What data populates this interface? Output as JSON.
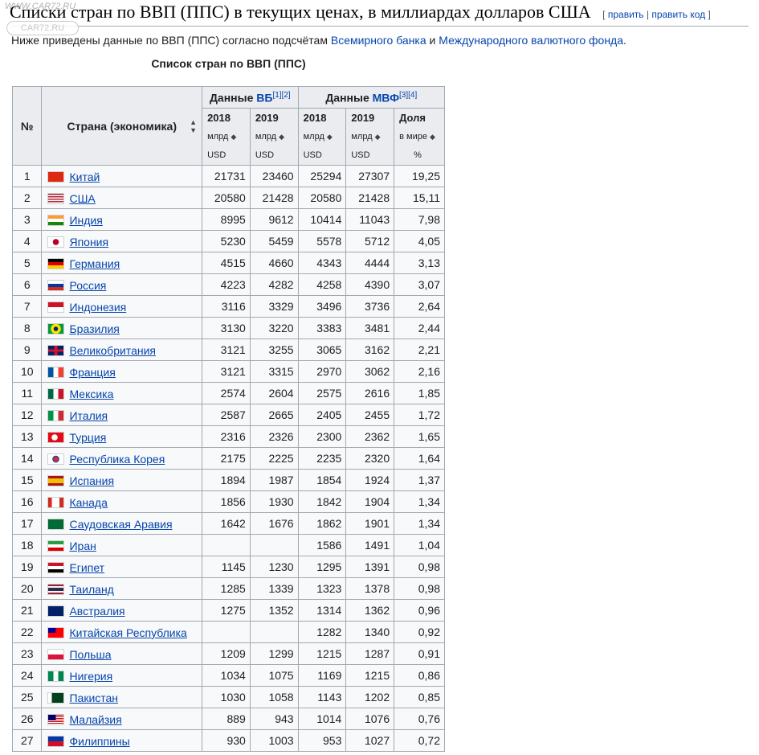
{
  "heading": {
    "title": "Списки стран по ВВП (ППС) в текущих ценах, в миллиардах долларов США",
    "edit_open": "[",
    "edit_label": "править",
    "edit_sep": "|",
    "edit_code_label": "править код",
    "edit_close": "]"
  },
  "watermark": {
    "url": "WWW.CAR72.RU",
    "logo": "CAR72.RU"
  },
  "intro": {
    "prefix": "Ниже приведены данные по ВВП (ППС) согласно подсчётам",
    "link1": "Всемирного банка",
    "and": "и",
    "link2": "Международного валютного фонда",
    "suffix": "."
  },
  "table": {
    "caption": "Список стран по ВВП (ППС)",
    "headers": {
      "num": "№",
      "country": "Страна (экономика)",
      "wb_prefix": "Данные",
      "wb_link": "ВБ",
      "wb_refs": "[1][2]",
      "imf_prefix": "Данные",
      "imf_link": "МВФ",
      "imf_refs": "[3][4]",
      "y2018": "2018",
      "y2019": "2019",
      "unit_line1": "млрд",
      "unit_line2": "USD",
      "share_line1": "Доля",
      "share_line2": "в мире",
      "share_line3": "%"
    },
    "rows": [
      {
        "n": "1",
        "flag": "cn",
        "country": "Китай",
        "wb2018": "21731",
        "wb2019": "23460",
        "imf2018": "25294",
        "imf2019": "27307",
        "share": "19,25"
      },
      {
        "n": "2",
        "flag": "us",
        "country": "США",
        "wb2018": "20580",
        "wb2019": "21428",
        "imf2018": "20580",
        "imf2019": "21428",
        "share": "15,11"
      },
      {
        "n": "3",
        "flag": "in",
        "country": "Индия",
        "wb2018": "8995",
        "wb2019": "9612",
        "imf2018": "10414",
        "imf2019": "11043",
        "share": "7,98"
      },
      {
        "n": "4",
        "flag": "jp",
        "country": "Япония",
        "wb2018": "5230",
        "wb2019": "5459",
        "imf2018": "5578",
        "imf2019": "5712",
        "share": "4,05"
      },
      {
        "n": "5",
        "flag": "de",
        "country": "Германия",
        "wb2018": "4515",
        "wb2019": "4660",
        "imf2018": "4343",
        "imf2019": "4444",
        "share": "3,13"
      },
      {
        "n": "6",
        "flag": "ru",
        "country": "Россия",
        "wb2018": "4223",
        "wb2019": "4282",
        "imf2018": "4258",
        "imf2019": "4390",
        "share": "3,07"
      },
      {
        "n": "7",
        "flag": "id",
        "country": "Индонезия",
        "wb2018": "3116",
        "wb2019": "3329",
        "imf2018": "3496",
        "imf2019": "3736",
        "share": "2,64"
      },
      {
        "n": "8",
        "flag": "br",
        "country": "Бразилия",
        "wb2018": "3130",
        "wb2019": "3220",
        "imf2018": "3383",
        "imf2019": "3481",
        "share": "2,44"
      },
      {
        "n": "9",
        "flag": "gb",
        "country": "Великобритания",
        "wb2018": "3121",
        "wb2019": "3255",
        "imf2018": "3065",
        "imf2019": "3162",
        "share": "2,21"
      },
      {
        "n": "10",
        "flag": "fr",
        "country": "Франция",
        "wb2018": "3121",
        "wb2019": "3315",
        "imf2018": "2970",
        "imf2019": "3062",
        "share": "2,16"
      },
      {
        "n": "11",
        "flag": "mx",
        "country": "Мексика",
        "wb2018": "2574",
        "wb2019": "2604",
        "imf2018": "2575",
        "imf2019": "2616",
        "share": "1,85"
      },
      {
        "n": "12",
        "flag": "it",
        "country": "Италия",
        "wb2018": "2587",
        "wb2019": "2665",
        "imf2018": "2405",
        "imf2019": "2455",
        "share": "1,72"
      },
      {
        "n": "13",
        "flag": "tr",
        "country": "Турция",
        "wb2018": "2316",
        "wb2019": "2326",
        "imf2018": "2300",
        "imf2019": "2362",
        "share": "1,65"
      },
      {
        "n": "14",
        "flag": "kr",
        "country": "Республика Корея",
        "wb2018": "2175",
        "wb2019": "2225",
        "imf2018": "2235",
        "imf2019": "2320",
        "share": "1,64"
      },
      {
        "n": "15",
        "flag": "es",
        "country": "Испания",
        "wb2018": "1894",
        "wb2019": "1987",
        "imf2018": "1854",
        "imf2019": "1924",
        "share": "1,37"
      },
      {
        "n": "16",
        "flag": "ca",
        "country": "Канада",
        "wb2018": "1856",
        "wb2019": "1930",
        "imf2018": "1842",
        "imf2019": "1904",
        "share": "1,34"
      },
      {
        "n": "17",
        "flag": "sa",
        "country": "Саудовская Аравия",
        "wb2018": "1642",
        "wb2019": "1676",
        "imf2018": "1862",
        "imf2019": "1901",
        "share": "1,34"
      },
      {
        "n": "18",
        "flag": "ir",
        "country": "Иран",
        "wb2018": "",
        "wb2019": "",
        "imf2018": "1586",
        "imf2019": "1491",
        "share": "1,04"
      },
      {
        "n": "19",
        "flag": "eg",
        "country": "Египет",
        "wb2018": "1145",
        "wb2019": "1230",
        "imf2018": "1295",
        "imf2019": "1391",
        "share": "0,98"
      },
      {
        "n": "20",
        "flag": "th",
        "country": "Таиланд",
        "wb2018": "1285",
        "wb2019": "1339",
        "imf2018": "1323",
        "imf2019": "1378",
        "share": "0,98"
      },
      {
        "n": "21",
        "flag": "au",
        "country": "Австралия",
        "wb2018": "1275",
        "wb2019": "1352",
        "imf2018": "1314",
        "imf2019": "1362",
        "share": "0,96"
      },
      {
        "n": "22",
        "flag": "tw",
        "country": "Китайская Республика",
        "wb2018": "",
        "wb2019": "",
        "imf2018": "1282",
        "imf2019": "1340",
        "share": "0,92"
      },
      {
        "n": "23",
        "flag": "pl",
        "country": "Польша",
        "wb2018": "1209",
        "wb2019": "1299",
        "imf2018": "1215",
        "imf2019": "1287",
        "share": "0,91"
      },
      {
        "n": "24",
        "flag": "ng",
        "country": "Нигерия",
        "wb2018": "1034",
        "wb2019": "1075",
        "imf2018": "1169",
        "imf2019": "1215",
        "share": "0,86"
      },
      {
        "n": "25",
        "flag": "pk",
        "country": "Пакистан",
        "wb2018": "1030",
        "wb2019": "1058",
        "imf2018": "1143",
        "imf2019": "1202",
        "share": "0,85"
      },
      {
        "n": "26",
        "flag": "my",
        "country": "Малайзия",
        "wb2018": "889",
        "wb2019": "943",
        "imf2018": "1014",
        "imf2019": "1076",
        "share": "0,76"
      },
      {
        "n": "27",
        "flag": "ph",
        "country": "Филиппины",
        "wb2018": "930",
        "wb2019": "1003",
        "imf2018": "953",
        "imf2019": "1027",
        "share": "0,72"
      }
    ]
  },
  "colors": {
    "link": "#0645ad",
    "header_bg": "#eaecf0",
    "cell_bg": "#f8f9fa",
    "border": "#a2a9b1"
  }
}
